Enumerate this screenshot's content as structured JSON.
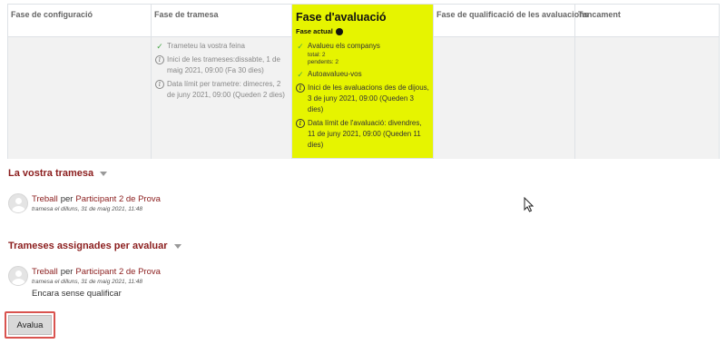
{
  "phases": [
    {
      "title": "Fase de configuració"
    },
    {
      "title": "Fase de tramesa",
      "tasks": [
        {
          "icon": "check-icon",
          "text": "Trameteu la vostra feina"
        },
        {
          "icon": "info-icon",
          "text": "Inici de les trameses:dissabte, 1 de maig 2021, 09:00 (Fa 30 dies)"
        },
        {
          "icon": "info-icon",
          "text": "Data límit per trametre: dimecres, 2 de juny 2021, 09:00 (Queden 2 dies)"
        }
      ]
    },
    {
      "title": "Fase d'avaluació",
      "subtitle": "Fase actual",
      "tasks": [
        {
          "icon": "check-icon",
          "text": "Avalueu els companys",
          "sub": [
            "total: 2",
            "pendents: 2"
          ]
        },
        {
          "icon": "check-icon",
          "text": "Autoavalueu-vos"
        },
        {
          "icon": "info-icon",
          "text": "Inici de les avaluacions des de dijous, 3 de juny 2021, 09:00 (Queden 3 dies)"
        },
        {
          "icon": "info-icon",
          "text": "Data límit de l'avaluació: divendres, 11 de juny 2021, 09:00 (Queden 11 dies)"
        }
      ]
    },
    {
      "title": "Fase de qualificació de les avaluacions"
    },
    {
      "title": "Tancament"
    }
  ],
  "colors": {
    "active_phase": "#e6f400",
    "link": "#8b1d1d",
    "highlight_border": "#d9534f"
  },
  "your_submission": {
    "heading": "La vostra tramesa",
    "item": {
      "title": "Treball",
      "by": "per",
      "author": "Participant 2 de Prova",
      "meta": "tramesa el dilluns, 31 de maig 2021, 11:48"
    }
  },
  "assigned": {
    "heading": "Trameses assignades per avaluar",
    "item": {
      "title": "Treball",
      "by": "per",
      "author": "Participant 2 de Prova",
      "meta": "tramesa el dilluns, 31 de maig 2021, 11:48",
      "note": "Encara sense qualificar"
    },
    "button": "Avalua"
  }
}
